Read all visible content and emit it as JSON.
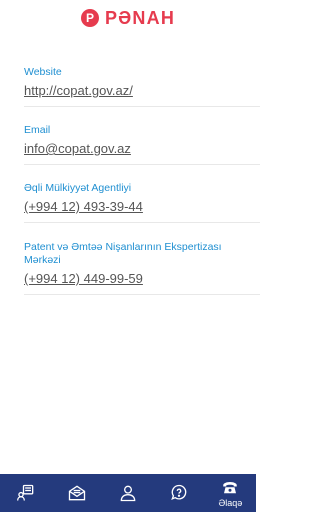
{
  "app": {
    "logo_letter": "P",
    "name": "PƏNAH"
  },
  "contacts": [
    {
      "label": "Website",
      "value": "http://copat.gov.az/"
    },
    {
      "label": "Email",
      "value": "info@copat.gov.az"
    },
    {
      "label": "Əqli Mülkiyyət Agentliyi",
      "value": "(+994 12) 493-39-44"
    },
    {
      "label": "Patent və Əmtəə Nişanlarının Ekspertizası Mərkəzi",
      "value": "(+994 12) 449-99-59"
    }
  ],
  "bottom_nav": {
    "active_label": "Əlaqə",
    "items": [
      "chat-list-icon",
      "mail-icon",
      "person-icon",
      "help-chat-icon",
      "phone-icon"
    ]
  },
  "colors": {
    "accent": "#e63b4e",
    "link": "#1f8fd1",
    "nav_bg": "#243a7d"
  }
}
